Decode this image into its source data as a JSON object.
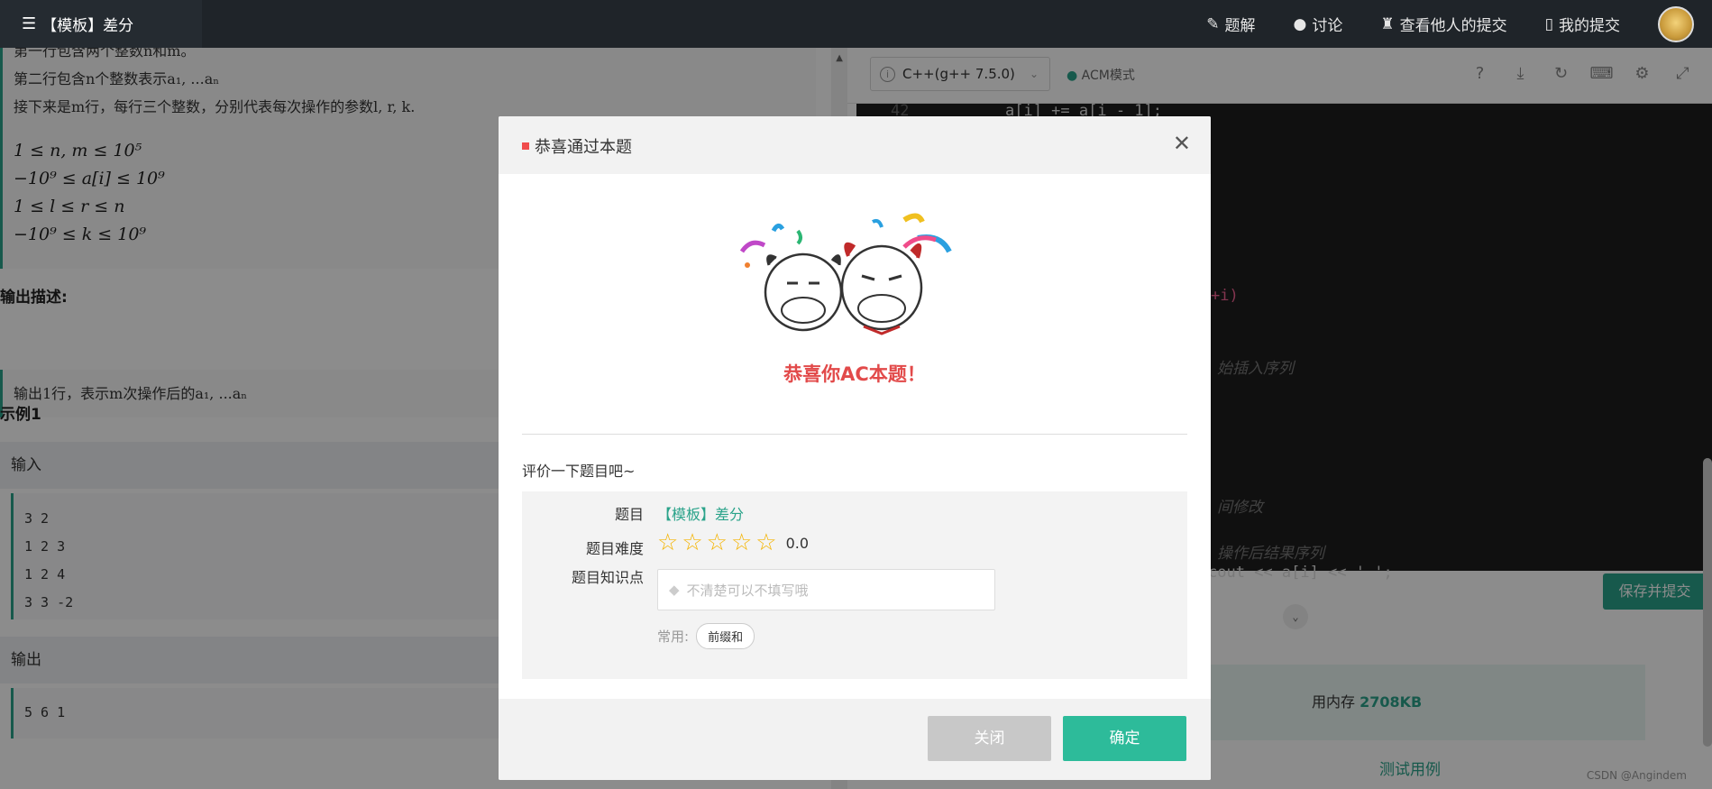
{
  "topbar": {
    "tab_title": "【模板】差分",
    "nav": [
      {
        "icon": "edit-icon",
        "label": "题解"
      },
      {
        "icon": "chat-icon",
        "label": "讨论"
      },
      {
        "icon": "trophy-icon",
        "label": "查看他人的提交"
      },
      {
        "icon": "file-icon",
        "label": "我的提交"
      }
    ]
  },
  "problem": {
    "input_desc_lines": [
      "第一行包含两个整数n和m。",
      "第二行包含n个整数表示a₁, ...aₙ",
      "接下来是m行，每行三个整数，分别代表每次操作的参数l, r, k."
    ],
    "constraints": [
      "1 ≤ n, m ≤ 10⁵",
      "−10⁹ ≤ a[i] ≤ 10⁹",
      "1 ≤ l ≤ r ≤ n",
      "−10⁹ ≤ k ≤ 10⁹"
    ],
    "output_heading": "输出描述:",
    "output_desc": "输出1行，表示m次操作后的a₁, ...aₙ",
    "example_heading": "示例1",
    "input_label": "输入",
    "input_lines": [
      "3 2",
      "1 2 3",
      "1 2 4",
      "3 3 -2"
    ],
    "output_label": "输出",
    "output_lines": [
      "5 6 1"
    ]
  },
  "editor": {
    "language": "C++(g++ 7.5.0)",
    "mode": "ACM模式",
    "line_number": "42",
    "code_line_42": "a[i] += a[i - 1];",
    "frag_i": "+i)",
    "frag_insert": "始插入序列",
    "frag_modify": "间修改",
    "frag_result": "操作后结果序列",
    "frag_cout": "cout << a[i] << ' ';",
    "save_label": "保存并提交",
    "memory_text": "用内存",
    "memory_value": "2708KB",
    "self_test": "测试用例",
    "watermark": "CSDN @Angindem"
  },
  "modal": {
    "title": "恭喜通过本题",
    "congrats": "恭喜你AC本题！",
    "rate_prompt": "评价一下题目吧~",
    "label_problem": "题目",
    "problem_name": "【模板】差分",
    "label_difficulty": "题目难度",
    "difficulty_score": "0.0",
    "difficulty_stars": 0,
    "label_knowledge": "题目知识点",
    "tag_placeholder": "不清楚可以不填写哦",
    "common_label": "常用:",
    "common_tags": [
      "前缀和"
    ],
    "close_label": "关闭",
    "ok_label": "确定"
  },
  "colors": {
    "accent": "#2aa38a",
    "congrats": "#e24a4a",
    "star": "#f4b400"
  }
}
